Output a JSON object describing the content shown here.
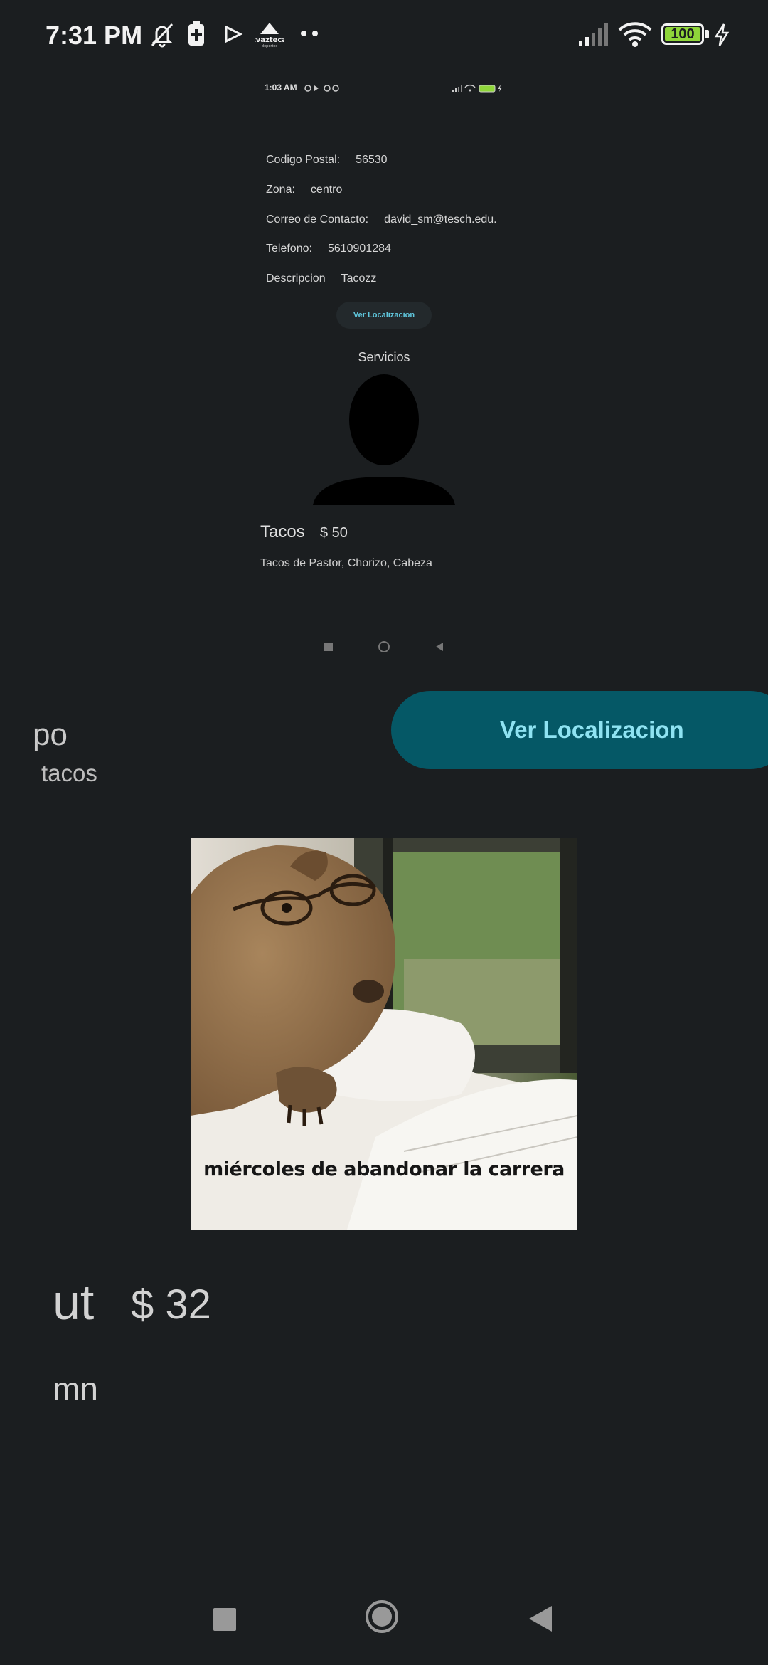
{
  "status_bar": {
    "time": "7:31 PM",
    "battery": "100",
    "icons": [
      "notifications-off-icon",
      "battery-saver-icon",
      "play-icon",
      "tv-azteca-icon",
      "more-dots-icon",
      "signal-icon",
      "wifi-icon",
      "battery-icon",
      "charging-icon"
    ]
  },
  "embedded_screen": {
    "status_time": "1:03 AM",
    "battery": "100",
    "fields": [
      {
        "label": "Codigo Postal:",
        "value": "56530"
      },
      {
        "label": "Zona:",
        "value": "centro"
      },
      {
        "label": "Correo de Contacto:",
        "value": "david_sm@tesch.edu."
      },
      {
        "label": "Telefono:",
        "value": "5610901284"
      },
      {
        "label": "Descripcion",
        "value": "Tacozz"
      }
    ],
    "button_label": "Ver Localizacion",
    "services_title": "Servicios",
    "dish": {
      "name": "Tacos",
      "price": "$ 50",
      "description": "Tacos de Pastor, Chorizo, Cabeza"
    },
    "nav_icons": [
      "recents-square-icon",
      "home-circle-icon",
      "back-triangle-icon"
    ]
  },
  "main": {
    "title_partial": "po",
    "subtitle": "tacos",
    "button_label": "Ver Localizacion",
    "image_caption": "miércoles de abandonar la carrera",
    "item_name_partial": "ut",
    "item_price": "$ 32",
    "item_desc_partial": "mn"
  },
  "nav_bar": {
    "icons": [
      "recents-square-icon",
      "home-circle-icon",
      "back-triangle-icon"
    ]
  },
  "colors": {
    "background": "#1b1e20",
    "button_bg": "#055866",
    "button_text": "#8fe3f2"
  }
}
